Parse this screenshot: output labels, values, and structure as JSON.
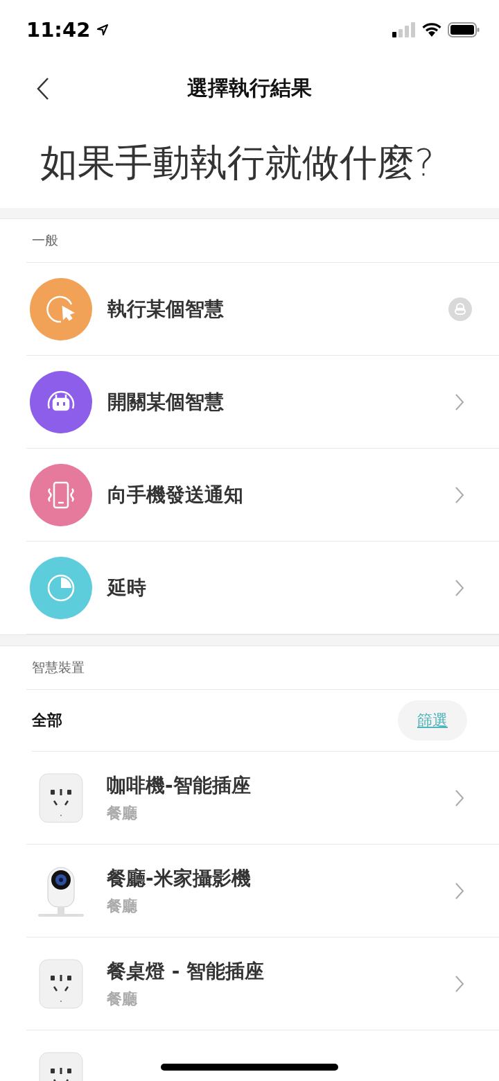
{
  "status_bar": {
    "time": "11:42"
  },
  "nav": {
    "title": "選擇執行結果"
  },
  "headline": "如果手動執行就做什麼?",
  "general": {
    "header": "一般",
    "items": [
      {
        "label": "執行某個智慧",
        "kind": "cursor",
        "color": "#f2a256",
        "locked": true
      },
      {
        "label": "開關某個智慧",
        "kind": "robot",
        "color": "#8c5eea",
        "locked": false
      },
      {
        "label": "向手機發送通知",
        "kind": "phone",
        "color": "#e57a9c",
        "locked": false
      },
      {
        "label": "延時",
        "kind": "clock",
        "color": "#5ecddb",
        "locked": false
      }
    ]
  },
  "devices": {
    "header": "智慧裝置",
    "filter_label": "全部",
    "filter_button": "篩選",
    "items": [
      {
        "name": "咖啡機-智能插座",
        "room": "餐廳",
        "kind": "plug"
      },
      {
        "name": "餐廳-米家攝影機",
        "room": "餐廳",
        "kind": "camera"
      },
      {
        "name": "餐桌燈 - 智能插座",
        "room": "餐廳",
        "kind": "plug"
      },
      {
        "kind": "plug"
      }
    ]
  }
}
